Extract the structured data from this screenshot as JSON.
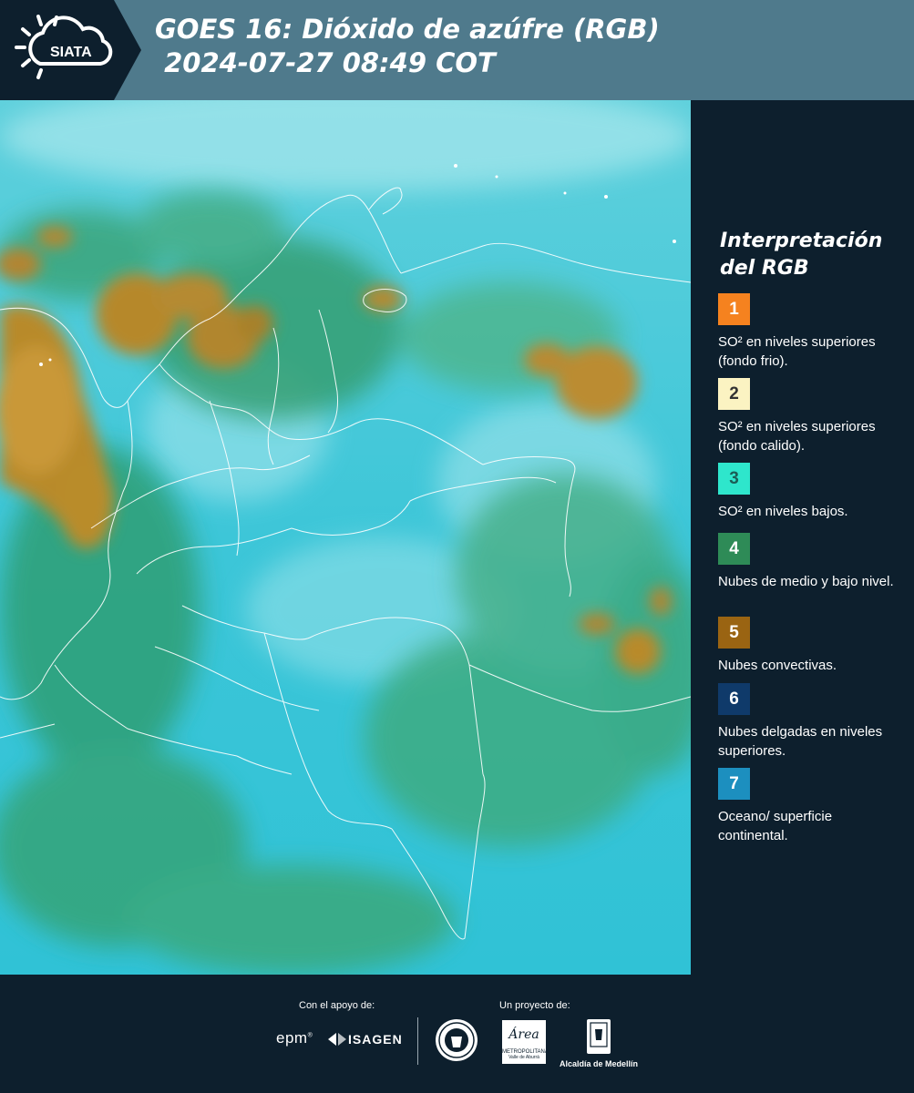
{
  "header": {
    "title_line1": "GOES 16: Dióxido de azúfre (RGB)",
    "title_line2": " 2024-07-27 08:49 COT",
    "logo_text": "SIATA"
  },
  "colors": {
    "header_bg": "#4f7a8c",
    "dark_bg": "#0d1f2d",
    "map_base": "#3fc6d6"
  },
  "legend": {
    "title_line1": "Interpretación",
    "title_line2": "del RGB",
    "items": [
      {
        "num": "1",
        "text": "SO² en niveles superiores (fondo frio).",
        "color": "#f5821f",
        "num_color": "#ffffff"
      },
      {
        "num": "2",
        "text": "SO² en niveles superiores (fondo calido).",
        "color": "#fbf3c2",
        "num_color": "#333333"
      },
      {
        "num": "3",
        "text": "SO² en niveles bajos.",
        "color": "#2ee6cc",
        "num_color": "#1b5d56"
      },
      {
        "num": "4",
        "text": "Nubes de medio y bajo nivel.",
        "color": "#2e8b57",
        "num_color": "#ffffff"
      },
      {
        "num": "5",
        "text": "Nubes convectivas.",
        "color": "#9a6412",
        "num_color": "#ffffff"
      },
      {
        "num": "6",
        "text": "Nubes delgadas en niveles superiores.",
        "color": "#0f3a6a",
        "num_color": "#ffffff"
      },
      {
        "num": "7",
        "text": "Oceano/ superficie continental.",
        "color": "#1c8fbf",
        "num_color": "#ffffff"
      }
    ]
  },
  "footer": {
    "support_label": "Con el apoyo de:",
    "project_label": "Un proyecto de:",
    "sponsor1": "epm",
    "sponsor2": "ISAGEN",
    "partner1": "METROPOLITANA",
    "partner1_sub": "Valle de Aburrá",
    "partner1_script": "Área",
    "partner2": "Alcaldía de Medellín"
  }
}
